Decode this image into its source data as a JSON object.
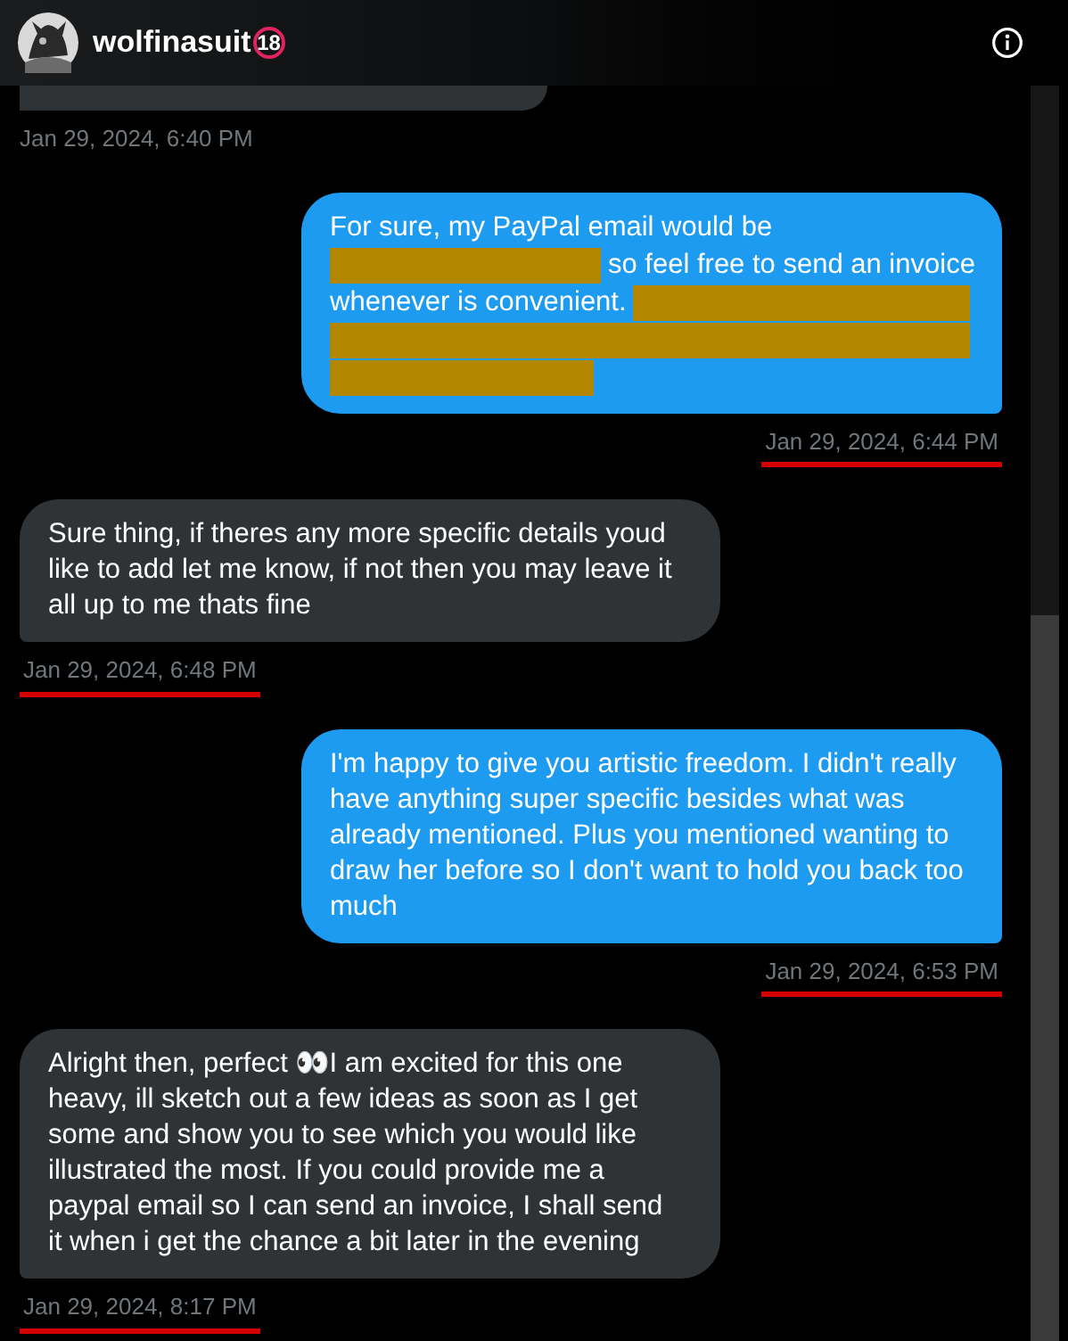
{
  "header": {
    "name": "wolfinasuit",
    "badge": "18"
  },
  "messages": [
    {
      "kind": "received",
      "partial": true,
      "timestamp": "Jan 29, 2024, 6:40 PM",
      "underlined": false
    },
    {
      "kind": "sent",
      "lines": [
        [
          {
            "kind": "text",
            "text": "For sure, my PayPal email would be"
          }
        ],
        [
          {
            "kind": "redaction"
          },
          {
            "kind": "text",
            "text": "so feel free to send an invoice"
          }
        ],
        [
          {
            "kind": "text",
            "text": "whenever is convenient."
          },
          {
            "kind": "redaction"
          }
        ],
        [
          {
            "kind": "redaction"
          }
        ],
        [
          {
            "kind": "redaction"
          }
        ]
      ],
      "timestamp": "Jan 29, 2024, 6:44 PM",
      "underlined": true
    },
    {
      "kind": "received",
      "text": "Sure thing, if theres any more specific details youd like to add let me know, if not then you may leave it all up to me thats fine",
      "timestamp": "Jan 29, 2024, 6:48 PM",
      "underlined": true
    },
    {
      "kind": "sent",
      "text": "I'm happy to give you artistic freedom. I didn't really have anything super specific besides what was already mentioned. Plus you mentioned wanting to draw her before so I don't want to hold you back too much",
      "timestamp": "Jan 29, 2024, 6:53 PM",
      "underlined": true
    },
    {
      "kind": "received",
      "text": "Alright then, perfect 👀I am excited for this one heavy, ill sketch out a few ideas as soon as I get some and show you to see which you would like illustrated the most. If you could provide me a paypal email so I can send an invoice, I shall send it when i get the chance a bit later in the evening",
      "timestamp": "Jan 29, 2024, 8:17 PM",
      "underlined": true
    }
  ]
}
